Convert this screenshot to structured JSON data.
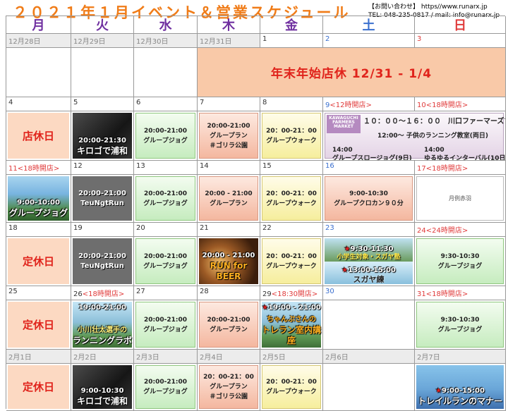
{
  "title": "２０２１年１月イベント＆営業スケジュール",
  "contact": {
    "line1": "【お問い合わせ】 https//www.runarx.jp",
    "line2": "TEL: 048-235-0817 / mail: info@runarx.jp"
  },
  "weekdays": [
    "月",
    "火",
    "水",
    "木",
    "金",
    "土",
    "日"
  ],
  "colors": {
    "closed_red": "#e0231b",
    "title_orange": "#f07c18",
    "weekday_purple": "#7030a0",
    "sat_blue": "#3a6fcf",
    "sun_red": "#e03b3b",
    "green_event": "#c6ecbf",
    "pink_event": "#f4b79f",
    "yellow_event": "#f6ee9d"
  },
  "weeks": [
    {
      "dates": [
        "12月28日",
        "12月29日",
        "12月30日",
        "12月31日",
        "1",
        "2",
        "3"
      ],
      "banner": "年末年始店休 12/31 - 1/4"
    },
    {
      "dates": [
        "4",
        "5",
        "6",
        "7",
        "8",
        "9",
        "10"
      ],
      "notes": {
        "sat": "<12時開店>",
        "sun": "<18時開店>"
      },
      "mon": "店休日",
      "tue": {
        "time": "20:00-21:30",
        "caption": "キロゴで浦和"
      },
      "wed": {
        "time": "20:00-21:00",
        "name": "グループジョグ"
      },
      "thu": {
        "time": "20:00-21:00",
        "name": "グループラン",
        "sub": "＃ゴリラ公園"
      },
      "fri": {
        "time": "20：00-21：00",
        "name": "グループウォーク"
      },
      "weekend": {
        "logo": "KAWAGUCHI FARMERS MARKET",
        "line1": "１０：００～１６：００　川口ファーマーズマーケット",
        "line2": "12:00～ 子供のランニング教室(両日)",
        "line3a": "14:00",
        "line3b": "グループスロージョグ(9日)",
        "line4a": "14:00",
        "line4b": "ゆるゆるインターバル(10日)"
      }
    },
    {
      "dates": [
        "11",
        "12",
        "13",
        "14",
        "15",
        "16",
        "17"
      ],
      "notes": {
        "mon": "<18時開店>",
        "sun": "<18時開店>"
      },
      "mon": {
        "time": "9:00-10:00",
        "caption": "グループジョグ"
      },
      "tue": {
        "time": "20:00-21:00",
        "name": "TeuNgtRun"
      },
      "wed": {
        "time": "20:00-21:00",
        "name": "グループジョグ"
      },
      "thu": {
        "time": "20:00 - 21:00",
        "name": "グループラン"
      },
      "fri": {
        "time": "20：00-21：00",
        "name": "グループウォーク"
      },
      "sat": {
        "time": "9:00-10:30",
        "name": "グループクロカン９０分"
      },
      "sun": "月例赤羽"
    },
    {
      "dates": [
        "18",
        "19",
        "20",
        "21",
        "22",
        "23",
        "24"
      ],
      "notes": {
        "sun": "<24時開店>"
      },
      "mon": "定休日",
      "tue": {
        "time": "20:00-21:00",
        "name": "TeuNgtRun"
      },
      "wed": {
        "time": "20:00-21:00",
        "name": "グループジョグ"
      },
      "thu": {
        "time": "20:00 - 21:00",
        "caption": "RUN for BEER"
      },
      "fri": {
        "time": "20：00-21：00",
        "name": "グループウォーク"
      },
      "sat": {
        "time1": "9:30-11:30",
        "sub1": "小学生対象・スガヤ塾",
        "time2": "13:00-15:00",
        "sub2": "スガヤ練"
      },
      "sun": {
        "time": "9:30-10:30",
        "name": "グループジョグ"
      }
    },
    {
      "dates": [
        "25",
        "26",
        "27",
        "28",
        "29",
        "30",
        "31"
      ],
      "notes": {
        "tue": "<18時開店>",
        "fri": "<18:30開店>",
        "sun": "<18時開店>"
      },
      "mon": "定休日",
      "tue": {
        "time": "19:00-21:00",
        "caption1": "小川壮太選手の",
        "caption2": "ランニングラボ"
      },
      "wed": {
        "time": "20:00-21:00",
        "name": "グループジョグ"
      },
      "thu": {
        "time": "20:00-21:00",
        "name": "グループラン"
      },
      "fri": {
        "time": "19:00 - 21:00",
        "caption1": "ちゃんぷさんの",
        "caption2": "トレラン室内講座"
      },
      "sun": {
        "time": "9:30-10:30",
        "name": "グループジョグ"
      }
    },
    {
      "dates": [
        "2月1日",
        "2月2日",
        "2月3日",
        "2月4日",
        "2月5日",
        "2月6日",
        "2月7日"
      ],
      "mon": "定休日",
      "tue": {
        "time": "9:00-10:30",
        "caption": "キロゴで浦和"
      },
      "wed": {
        "time": "20:00-21:00",
        "name": "グループジョグ"
      },
      "thu": {
        "time": "20：00-21：00",
        "name": "グループラン",
        "sub": "＃ゴリラ公園"
      },
      "fri": {
        "time": "20：00-21：00",
        "name": "グループウォーク"
      },
      "sun": {
        "time": "9:00-15:00",
        "caption": "トレイルランのマナー"
      }
    }
  ]
}
